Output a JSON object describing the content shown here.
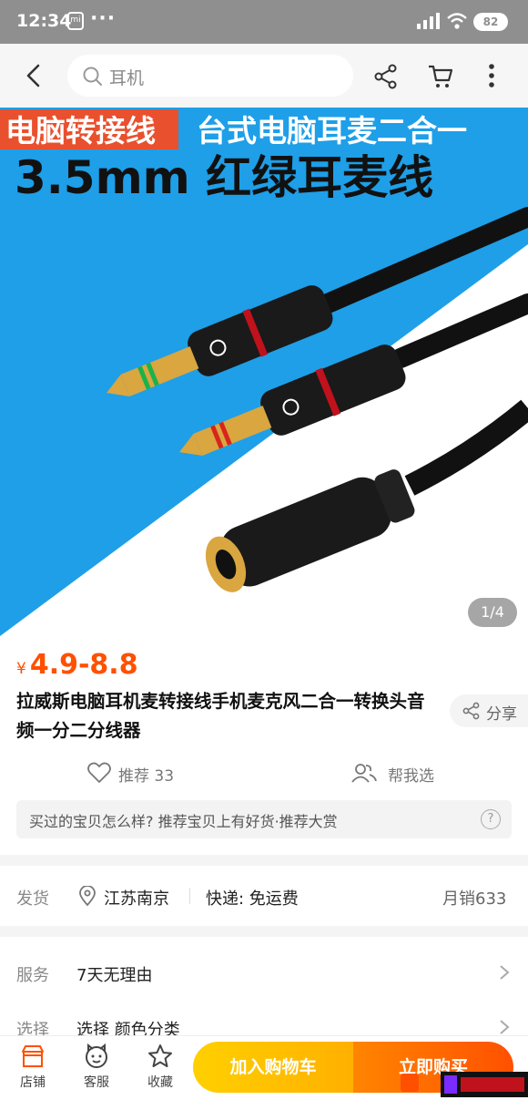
{
  "status_bar": {
    "time": "12:34",
    "mi_badge": "mi",
    "dots": "···",
    "battery": "82"
  },
  "nav": {
    "search_text": "耳机"
  },
  "product_image": {
    "tag_left": "电脑转接线",
    "tag_right": "台式电脑耳麦二合一",
    "headline": "3.5mm 红绿耳麦线",
    "counter": "1/4",
    "colors": {
      "blue": "#1e9fe8",
      "tag_red": "#e9502e",
      "gold": "#d9a640"
    }
  },
  "product": {
    "currency": "¥",
    "price_range": "4.9-8.8",
    "title": "拉威斯电脑耳机麦转接线手机麦克风二合一转换头音频一分二分线器",
    "share_label": "分享",
    "recommend_label": "推荐 33",
    "help_choose_label": "帮我选",
    "ask_prompt": "买过的宝贝怎么样? 推荐宝贝上有好货·推荐大赏",
    "ask_help": "?"
  },
  "shipping": {
    "label": "发货",
    "location": "江苏南京",
    "express": "快递: 免运费",
    "monthly_sales": "月销633"
  },
  "services": [
    {
      "label": "服务",
      "value": "7天无理由"
    },
    {
      "label": "选择",
      "value": "选择 颜色分类"
    }
  ],
  "bottom_bar": {
    "shop_label": "店铺",
    "service_label": "客服",
    "favorite_label": "收藏",
    "add_to_cart": "加入购物车",
    "buy_now": "立即购买"
  },
  "accent_color": "#ff5000"
}
